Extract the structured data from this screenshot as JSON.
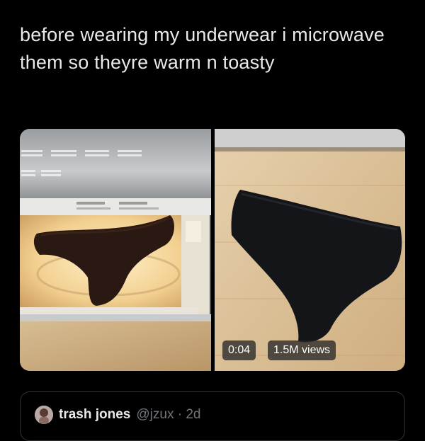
{
  "tweet": {
    "text": "before wearing my underwear i microwave them so theyre warm n toasty"
  },
  "media": {
    "left_image": "microwave-with-underwear-photo",
    "right_image": "black-underwear-on-floor-photo",
    "video_time": "0:04",
    "view_count": "1.5M views"
  },
  "quoted_tweet": {
    "display_name": "trash jones",
    "handle_and_time": "@jzux · 2d"
  },
  "colors": {
    "background": "#000000",
    "text": "#e7e9ea",
    "secondary_text": "#71767b",
    "border": "#2f3336"
  }
}
